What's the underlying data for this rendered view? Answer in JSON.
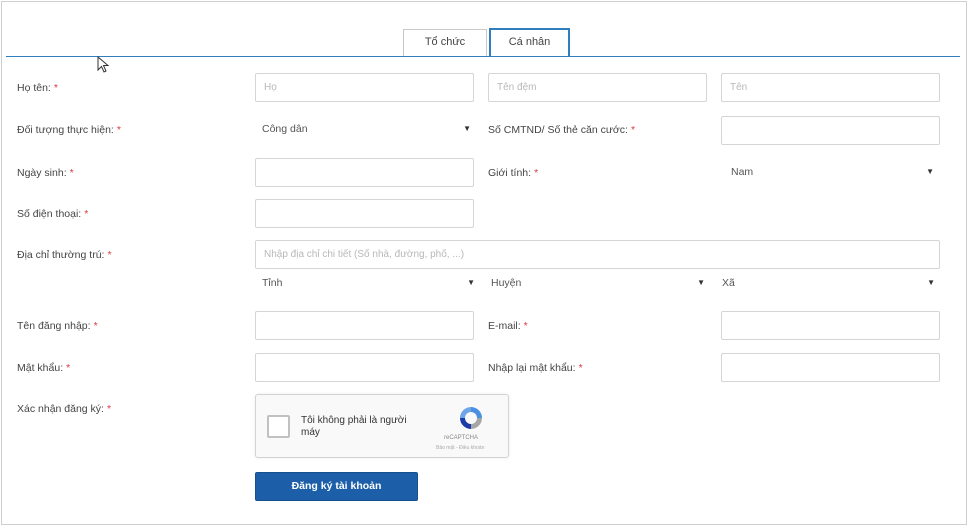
{
  "tabs": [
    {
      "label": "Tổ chức",
      "active": false
    },
    {
      "label": "Cá nhân",
      "active": true
    }
  ],
  "form": {
    "name_label": "Họ tên:",
    "name_placeholders": [
      "Họ",
      "Tên đệm",
      "Tên"
    ],
    "subject_label": "Đối tượng thực hiện:",
    "subject_value": "Công dân",
    "id_label": "Số CMTND/ Số thẻ căn cước:",
    "dob_label": "Ngày sinh:",
    "gender_label": "Giới tính:",
    "gender_value": "Nam",
    "phone_label": "Số điện thoại:",
    "address_label": "Địa chỉ thường trú:",
    "address_placeholder": "Nhập địa chỉ chi tiết (Số nhà, đường, phố, ...)",
    "province": "Tỉnh",
    "district": "Huyện",
    "ward": "Xã",
    "username_label": "Tên đăng nhập:",
    "email_label": "E-mail:",
    "password_label": "Mật khẩu:",
    "password_confirm_label": "Nhập lại mật khẩu:",
    "confirm_label": "Xác nhận đăng ký:",
    "required_mark": "*"
  },
  "captcha": {
    "text": "Tôi không phải là người máy",
    "brand": "reCAPTCHA",
    "terms": "Bảo mật - Điều khoản"
  },
  "submit_label": "Đăng ký tài khoản",
  "colors": {
    "accent": "#2f7fbf",
    "button": "#1c5fa8",
    "required": "#e0393c"
  },
  "icons": {
    "cursor": "cursor-arrow-icon",
    "select_caret": "triangle-down-icon",
    "recaptcha": "recaptcha-logo-icon"
  }
}
